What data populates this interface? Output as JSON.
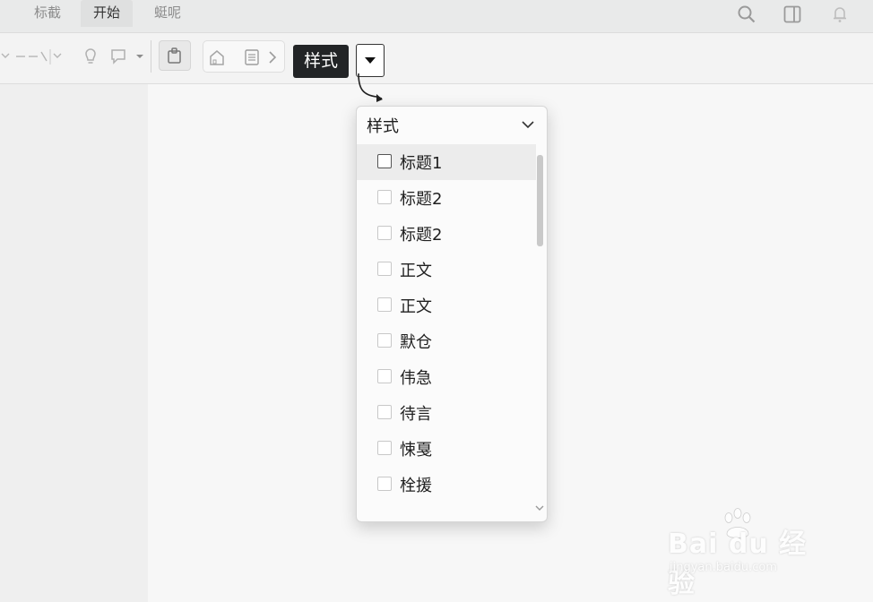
{
  "tabs": [
    {
      "label": "标截"
    },
    {
      "label": "开始"
    },
    {
      "label": "蜓呢"
    }
  ],
  "toolbar": {
    "style_button_label": "样式"
  },
  "styles_panel": {
    "title": "样式",
    "items": [
      {
        "label": "标题1",
        "selected": true
      },
      {
        "label": "标题2",
        "selected": false
      },
      {
        "label": "标题2",
        "selected": false
      },
      {
        "label": "正文",
        "selected": false
      },
      {
        "label": "正文",
        "selected": false
      },
      {
        "label": "默仓",
        "selected": false
      },
      {
        "label": "伟急",
        "selected": false
      },
      {
        "label": "待言",
        "selected": false
      },
      {
        "label": "悚戛",
        "selected": false
      },
      {
        "label": "栓援",
        "selected": false
      }
    ]
  },
  "watermark": {
    "brand": "Bai du 经验",
    "url": "jingyan.baidu.com"
  },
  "icons": [
    "search-icon",
    "layout-icon",
    "notification-icon",
    "paste-icon",
    "home-icon",
    "document-icon",
    "chevron-right-icon",
    "chevron-down-icon"
  ]
}
